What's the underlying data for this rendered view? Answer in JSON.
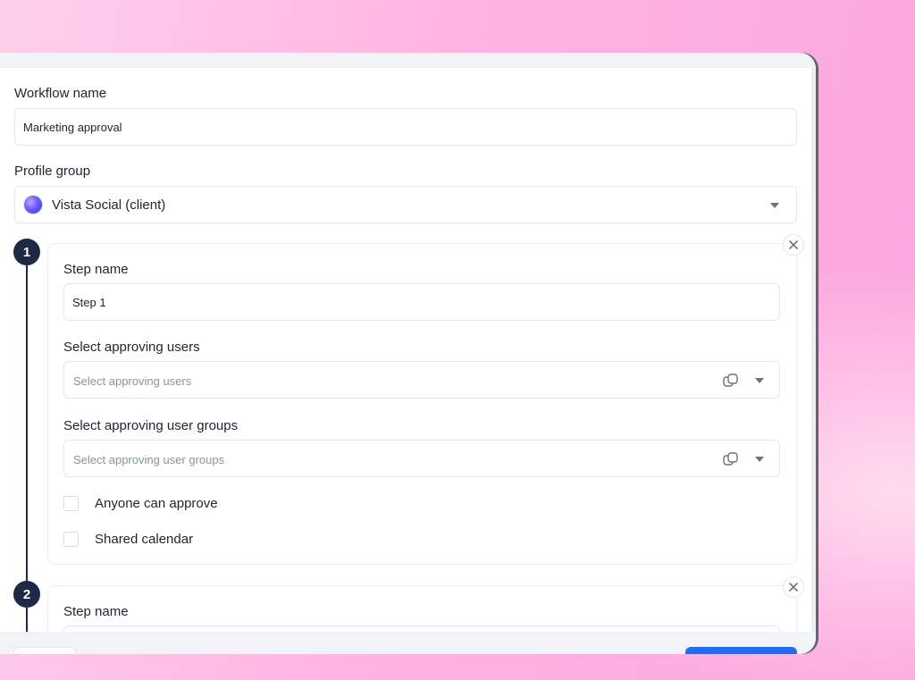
{
  "workflow": {
    "name_label": "Workflow name",
    "name_value": "Marketing approval"
  },
  "profile_group": {
    "label": "Profile group",
    "value": "Vista Social (client)"
  },
  "steps": [
    {
      "number": "1",
      "step_name_label": "Step name",
      "step_name_value": "Step 1",
      "users_label": "Select approving users",
      "users_placeholder": "Select approving users",
      "groups_label": "Select approving user groups",
      "groups_placeholder": "Select approving user groups",
      "anyone_label": "Anyone can approve",
      "shared_calendar_label": "Shared calendar"
    },
    {
      "number": "2",
      "step_name_label": "Step name"
    }
  ],
  "icons": {
    "close": "close-icon",
    "caret": "chevron-down-icon",
    "copy": "copy-icon"
  },
  "colors": {
    "accent": "#1f6df2",
    "step_dot": "#1e2a44",
    "background_pink": "#fba6dd"
  }
}
